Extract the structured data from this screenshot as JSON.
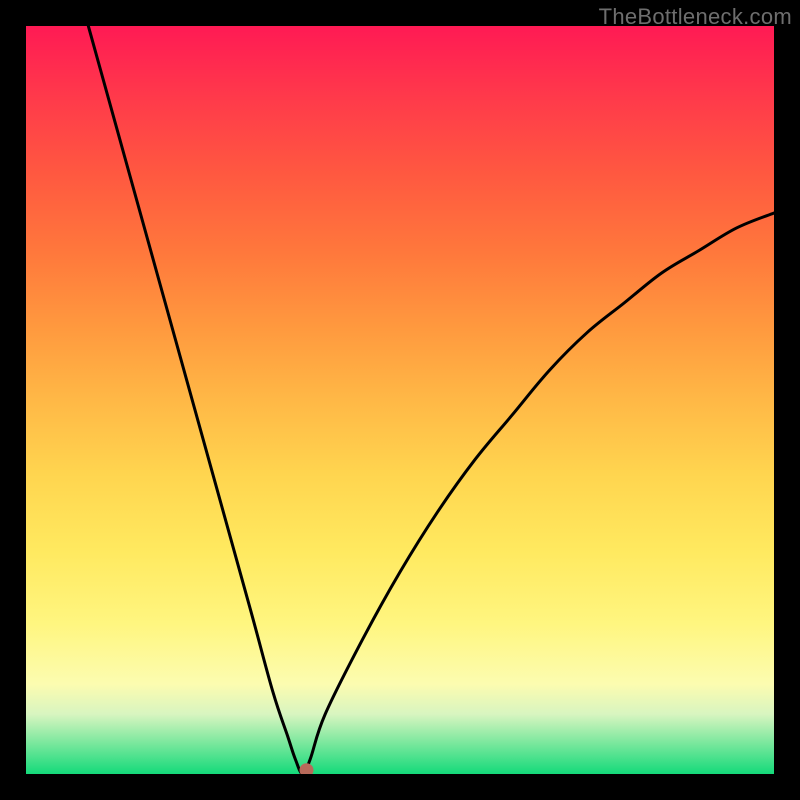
{
  "watermark": "TheBottleneck.com",
  "chart_data": {
    "type": "line",
    "title": "",
    "xlabel": "",
    "ylabel": "",
    "xlim": [
      0,
      100
    ],
    "ylim": [
      0,
      100
    ],
    "minimum_x": 37,
    "series": [
      {
        "name": "bottleneck-curve",
        "x": [
          0,
          5,
          10,
          15,
          20,
          25,
          30,
          33,
          35,
          36,
          37,
          38,
          40,
          45,
          50,
          55,
          60,
          65,
          70,
          75,
          80,
          85,
          90,
          95,
          100
        ],
        "values": [
          130,
          112,
          94,
          76,
          58,
          40,
          22,
          11,
          5,
          2,
          0,
          2,
          8,
          18,
          27,
          35,
          42,
          48,
          54,
          59,
          63,
          67,
          70,
          73,
          75
        ]
      }
    ],
    "marker": {
      "x": 37.5,
      "y": 0.5,
      "color": "#b86a5a",
      "radius": 7
    },
    "background_gradient": {
      "top": "#ff1a54",
      "mid": "#ffd54f",
      "bottom": "#14da7a"
    }
  }
}
